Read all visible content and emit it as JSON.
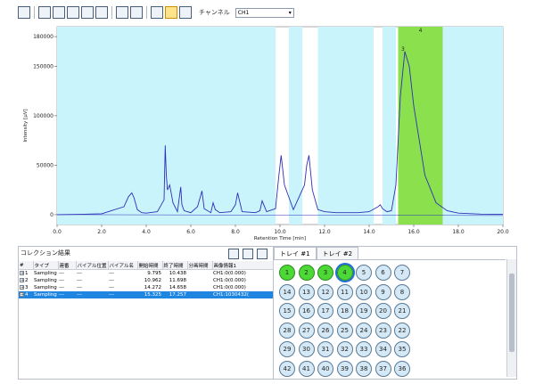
{
  "toolbar": {
    "channel_label": "チャンネル",
    "channel_value": "CH1",
    "icons": [
      "peak-table-icon",
      "zoom-icon",
      "window-icon",
      "report-icon",
      "cursor-icon",
      "link-icon",
      "baseline-icon",
      "integrate-icon",
      "peak-icon",
      "fraction-icon",
      "chromatogram-icon"
    ]
  },
  "chart_data": {
    "type": "line",
    "xlabel": "Retention Time [min]",
    "ylabel": "Intensity [μV]",
    "xlim": [
      0,
      20
    ],
    "ylim": [
      -10000,
      190000
    ],
    "x_ticks": [
      "0.0",
      "2.0",
      "4.0",
      "6.0",
      "8.0",
      "10.0",
      "12.0",
      "14.0",
      "16.0",
      "18.0",
      "20.0"
    ],
    "y_ticks": [
      "0",
      "50000",
      "100000",
      "150000",
      "180000"
    ],
    "fraction_regions": [
      [
        0,
        9.8
      ],
      [
        10.4,
        11.0
      ],
      [
        11.7,
        14.2
      ],
      [
        14.6,
        15.2
      ],
      [
        17.3,
        20
      ]
    ],
    "collection_region": [
      15.3,
      17.3
    ],
    "collection_label": "4",
    "peak_label": "3",
    "color_trace": "#2f2fb8",
    "color_fraction": "#c9f4fb",
    "color_collection": "#8be04e",
    "series": [
      {
        "x": [
          0,
          1,
          2,
          3,
          3.2,
          3.35,
          3.45,
          3.6,
          3.8,
          4,
          4.5,
          4.8,
          4.85,
          4.9,
          4.95,
          5.05,
          5.2,
          5.4,
          5.55,
          5.6,
          5.7,
          6,
          6.3,
          6.45,
          6.5,
          6.6,
          6.9,
          7,
          7.1,
          7.3,
          7.8,
          8,
          8.1,
          8.3,
          8.9,
          9.1,
          9.2,
          9.4,
          9.8,
          9.95,
          10.05,
          10.2,
          10.6,
          11.1,
          11.2,
          11.3,
          11.45,
          11.7,
          12.0,
          12.5,
          13.5,
          14,
          14.4,
          14.5,
          14.6,
          14.8,
          15,
          15.2,
          15.4,
          15.6,
          15.8,
          16,
          16.5,
          17,
          17.5,
          18,
          19,
          20
        ],
        "y": [
          0,
          300,
          900,
          8000,
          18000,
          22000,
          17000,
          5000,
          2000,
          1500,
          3000,
          15000,
          70000,
          40000,
          25000,
          30000,
          12000,
          3000,
          28000,
          10000,
          4000,
          2000,
          8000,
          20000,
          24000,
          6000,
          2000,
          12000,
          5000,
          2000,
          3000,
          10000,
          22000,
          3000,
          2000,
          4000,
          14000,
          3000,
          6000,
          40000,
          60000,
          30000,
          5000,
          30000,
          50000,
          60000,
          25000,
          5000,
          3000,
          2000,
          2000,
          3000,
          8000,
          10000,
          6000,
          3000,
          4000,
          30000,
          120000,
          165000,
          150000,
          110000,
          40000,
          12000,
          4000,
          1500,
          500,
          300
        ]
      }
    ]
  },
  "collection_panel": {
    "title": "コレクション結果",
    "headers": [
      "#",
      "タイプ",
      "連番",
      "バイアル位置",
      "バイアル名",
      "開始時間",
      "終了時間",
      "分画時間",
      "画像情報1"
    ],
    "rows": [
      [
        "1",
        "Sampling",
        "---",
        "---",
        "---",
        "9.795",
        "10.438",
        "",
        "CH1:0(0.000)"
      ],
      [
        "2",
        "Sampling",
        "---",
        "---",
        "---",
        "10.962",
        "11.698",
        "",
        "CH1:0(0.000)"
      ],
      [
        "3",
        "Sampling",
        "---",
        "---",
        "---",
        "14.272",
        "14.658",
        "",
        "CH1:0(0.000)"
      ],
      [
        "4",
        "Sampling",
        "---",
        "---",
        "---",
        "15.325",
        "17.257",
        "",
        "CH1:1030432("
      ]
    ],
    "selected_row": 3
  },
  "tray": {
    "tabs": [
      "トレイ #1",
      "トレイ #2"
    ],
    "active_tab": 0,
    "rows": [
      [
        1,
        2,
        3,
        4,
        5,
        6,
        7
      ],
      [
        14,
        13,
        12,
        11,
        10,
        9,
        8
      ],
      [
        15,
        16,
        17,
        18,
        19,
        20,
        21
      ],
      [
        28,
        27,
        26,
        25,
        24,
        23,
        22
      ],
      [
        29,
        30,
        31,
        32,
        33,
        34,
        35
      ],
      [
        42,
        41,
        40,
        39,
        38,
        37,
        36
      ]
    ],
    "collected": [
      1,
      2,
      3,
      4
    ],
    "current": 4
  }
}
